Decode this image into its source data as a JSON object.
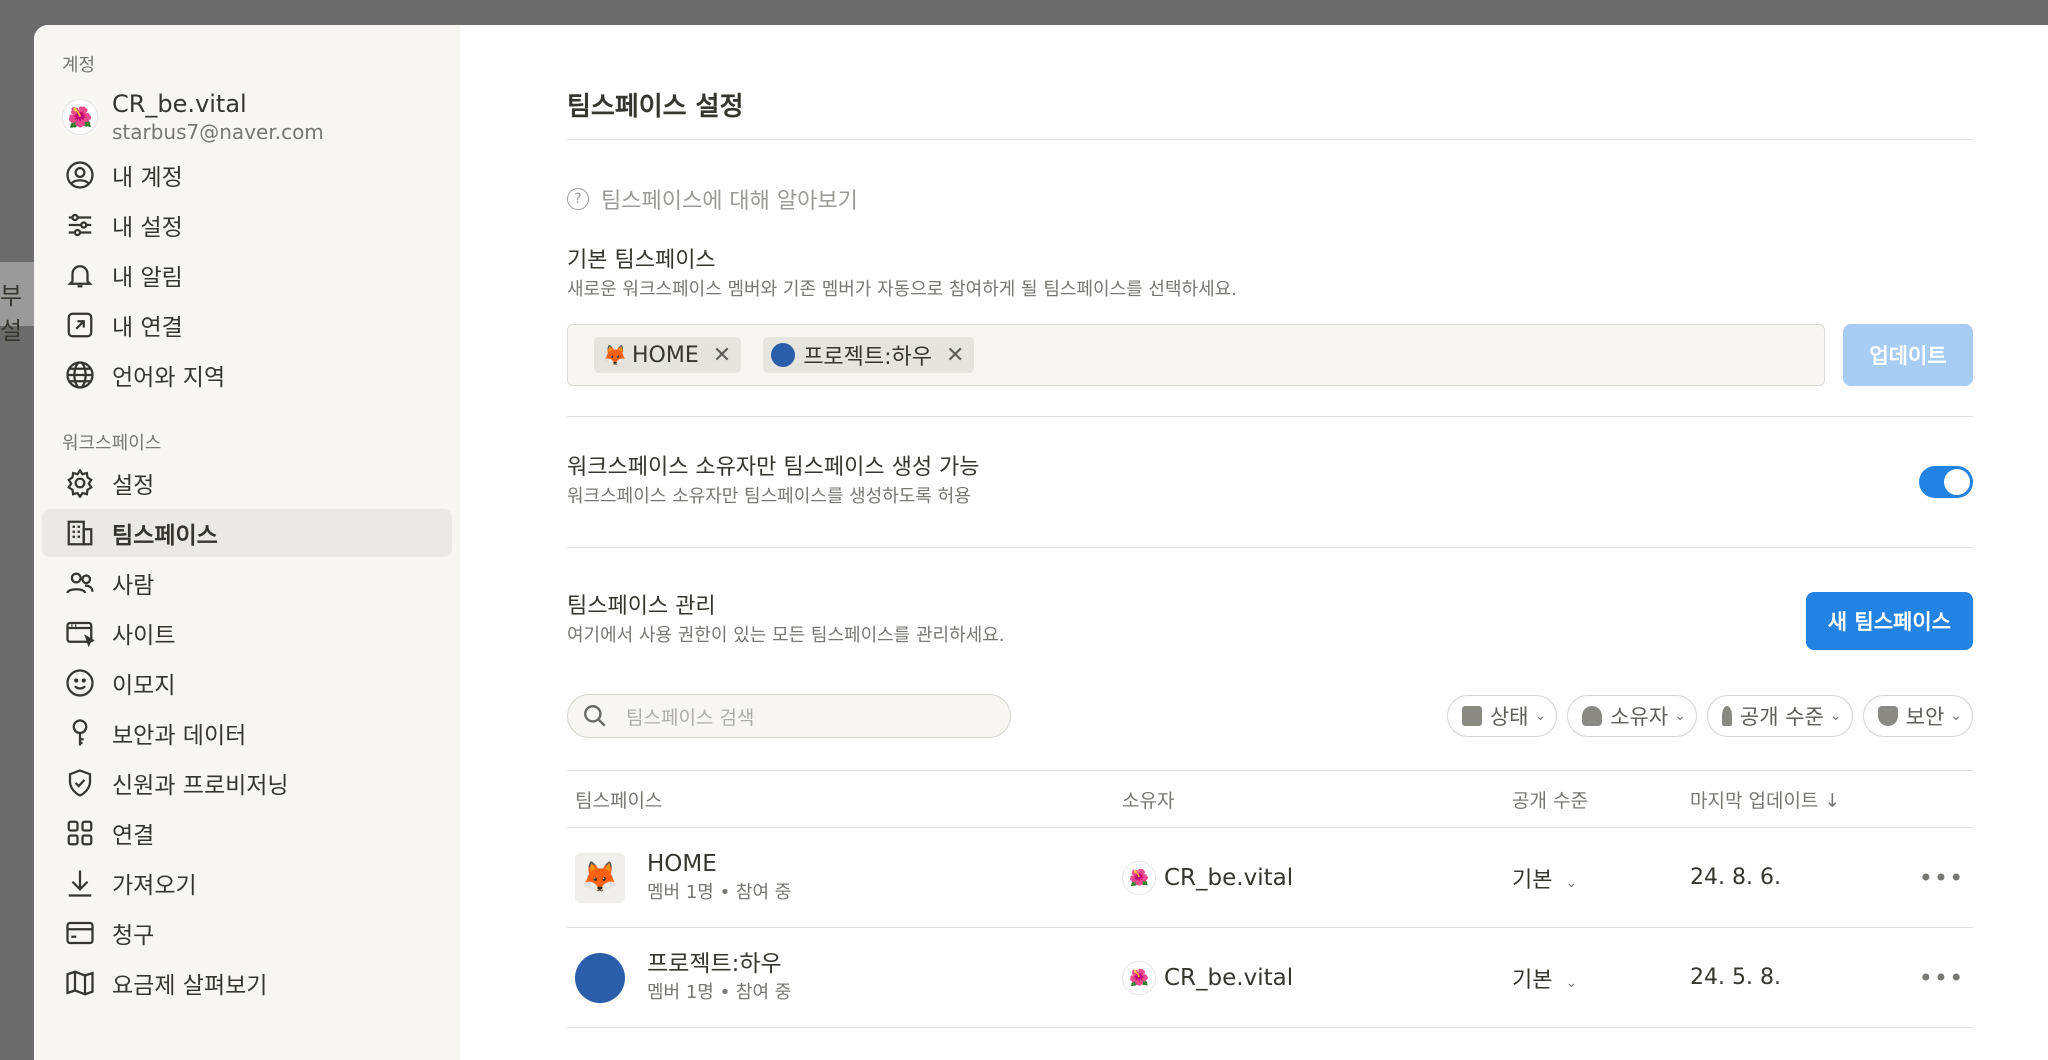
{
  "backdrop": {
    "fragment": "부 설"
  },
  "sidebar": {
    "account_section": "계정",
    "account": {
      "name": "CR_be.vital",
      "email": "starbus7@naver.com"
    },
    "account_items": [
      {
        "label": "내 계정",
        "icon": "user-circle-icon"
      },
      {
        "label": "내 설정",
        "icon": "sliders-icon"
      },
      {
        "label": "내 알림",
        "icon": "bell-icon"
      },
      {
        "label": "내 연결",
        "icon": "external-link-icon"
      },
      {
        "label": "언어와 지역",
        "icon": "globe-icon"
      }
    ],
    "workspace_section": "워크스페이스",
    "workspace_items": [
      {
        "label": "설정",
        "icon": "gear-icon"
      },
      {
        "label": "팀스페이스",
        "icon": "building-icon",
        "active": true
      },
      {
        "label": "사람",
        "icon": "people-icon"
      },
      {
        "label": "사이트",
        "icon": "browser-icon"
      },
      {
        "label": "이모지",
        "icon": "smiley-icon"
      },
      {
        "label": "보안과 데이터",
        "icon": "key-icon"
      },
      {
        "label": "신원과 프로비저닝",
        "icon": "shield-check-icon"
      },
      {
        "label": "연결",
        "icon": "grid-icon"
      },
      {
        "label": "가져오기",
        "icon": "download-icon"
      },
      {
        "label": "청구",
        "icon": "credit-card-icon"
      },
      {
        "label": "요금제 살펴보기",
        "icon": "map-icon"
      }
    ]
  },
  "main": {
    "title": "팀스페이스 설정",
    "learn_link": "팀스페이스에 대해 알아보기",
    "default": {
      "title": "기본 팀스페이스",
      "desc": "새로운 워크스페이스 멤버와 기존 멤버가 자동으로 참여하게 될 팀스페이스를 선택하세요.",
      "tags": [
        "HOME",
        "프로젝트:하우"
      ],
      "update_label": "업데이트"
    },
    "owner_only": {
      "title": "워크스페이스 소유자만 팀스페이스 생성 가능",
      "desc": "워크스페이스 소유자만 팀스페이스를 생성하도록 허용",
      "enabled": true
    },
    "manage": {
      "title": "팀스페이스 관리",
      "desc": "여기에서 사용 권한이 있는 모든 팀스페이스를 관리하세요.",
      "new_label": "새 팀스페이스"
    },
    "search_placeholder": "팀스페이스 검색",
    "filters": [
      "상태",
      "소유자",
      "공개 수준",
      "보안"
    ],
    "table": {
      "headers": [
        "팀스페이스",
        "소유자",
        "공개 수준",
        "마지막 업데이트"
      ],
      "rows": [
        {
          "name": "HOME",
          "meta": "멤버 1명 • 참여 중",
          "owner": "CR_be.vital",
          "access": "기본",
          "updated": "24. 8. 6."
        },
        {
          "name": "프로젝트:하우",
          "meta": "멤버 1명 • 참여 중",
          "owner": "CR_be.vital",
          "access": "기본",
          "updated": "24. 5. 8."
        }
      ]
    }
  },
  "colors": {
    "accent": "#2383e2",
    "update_disabled": "#a8cdf4",
    "sidebar_bg": "#f7f6f3"
  }
}
